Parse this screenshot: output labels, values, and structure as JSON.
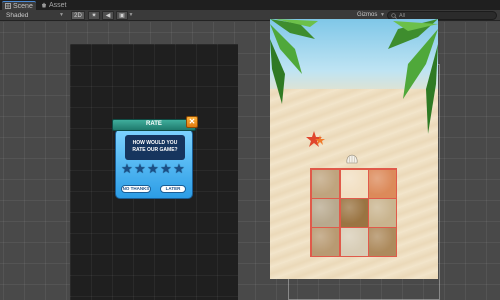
{
  "tabs": [
    {
      "label": "Scene",
      "icon": "scene-grid-icon",
      "active": true
    },
    {
      "label": "Asset Store",
      "icon": "store-icon",
      "active": false
    }
  ],
  "toolbar": {
    "shading_mode": "Shaded",
    "mode_2d": "2D",
    "lighting_icon": "sun-icon",
    "audio_icon": "audio-icon",
    "effects_icon": "image-effects-icon",
    "gizmos_label": "Gizmos",
    "search_placeholder": "All"
  },
  "rate_dialog": {
    "title": "RATE",
    "question_line1": "HOW WOULD YOU",
    "question_line2": "RATE OUR GAME?",
    "star_count": 5,
    "no_thanks_label": "NO THANKS",
    "later_label": "LATER",
    "close_icon": "close-icon"
  },
  "colors": {
    "accent_tab": "#4a8ad6",
    "dialog_blue": "#2c9de6",
    "dialog_ribbon": "#1f7a6d",
    "close_orange": "#e07a10",
    "grid_highlight": "#e05a4a"
  },
  "sand_tiles": [
    {
      "color": "#bfa47e"
    },
    {
      "color": "#f2dfc2"
    },
    {
      "color": "#dc8a5a"
    },
    {
      "color": "#b8a98e"
    },
    {
      "color": "#9a7442"
    },
    {
      "color": "#c9b48e"
    },
    {
      "color": "#b89a72"
    },
    {
      "color": "#d8cdb6"
    },
    {
      "color": "#ad8a5c"
    }
  ]
}
